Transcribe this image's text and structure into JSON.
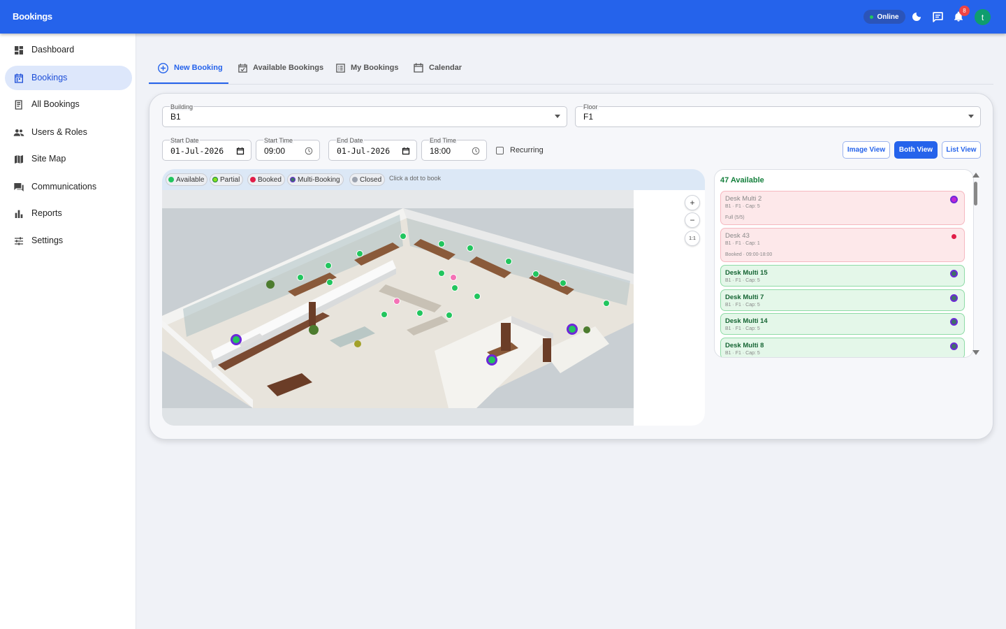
{
  "app": {
    "title": "Bookings"
  },
  "topbar": {
    "status": "Online",
    "notifications_count": "8",
    "avatar_initial": "t"
  },
  "sidebar": {
    "items": [
      {
        "label": "Dashboard",
        "icon": "dashboard-icon"
      },
      {
        "label": "Bookings",
        "icon": "calendar-icon",
        "active": true
      },
      {
        "label": "All Bookings",
        "icon": "book-icon"
      },
      {
        "label": "Users & Roles",
        "icon": "people-icon"
      },
      {
        "label": "Site Map",
        "icon": "map-icon"
      },
      {
        "label": "Communications",
        "icon": "chat-icon"
      },
      {
        "label": "Reports",
        "icon": "bar-chart-icon"
      },
      {
        "label": "Settings",
        "icon": "sliders-icon"
      }
    ]
  },
  "tabs": [
    {
      "label": "New Booking",
      "active": true
    },
    {
      "label": "Available Bookings"
    },
    {
      "label": "My Bookings"
    },
    {
      "label": "Calendar"
    }
  ],
  "form": {
    "building": {
      "label": "Building",
      "value": "B1"
    },
    "floor": {
      "label": "Floor",
      "value": "F1"
    },
    "start_date": {
      "label": "Start Date",
      "value": "01-Jul-2026"
    },
    "start_time": {
      "label": "Start Time",
      "value": "09:00"
    },
    "end_date": {
      "label": "End Date",
      "value": "01-Jul-2026"
    },
    "end_time": {
      "label": "End Time",
      "value": "18:00"
    },
    "recurring": {
      "label": "Recurring",
      "checked": false
    }
  },
  "views": {
    "image": "Image View",
    "both": "Both View",
    "list": "List View",
    "active": "both"
  },
  "legend": {
    "items": [
      {
        "label": "Available",
        "color": "#22c55e"
      },
      {
        "label": "Partial",
        "color": "#84e01f"
      },
      {
        "label": "Booked",
        "color": "#e11d48"
      },
      {
        "label": "Multi-Booking",
        "color": "#6d28d9"
      },
      {
        "label": "Closed",
        "color": "#9ca3af"
      }
    ],
    "hint": "Click a dot to book"
  },
  "zoom": {
    "in": "+",
    "out": "−",
    "reset": "1:1"
  },
  "list": {
    "available_count": "47 Available",
    "items": [
      {
        "title": "Desk Multi 2",
        "sub": "B1 · F1 · Cap: 5",
        "status": "Full (5/5)",
        "state": "booked",
        "dot": "#c026d3"
      },
      {
        "title": "Desk 43",
        "sub": "B1 · F1 · Cap: 1",
        "status": "Booked · 09:00-18:00",
        "state": "booked",
        "dot": "#e11d48"
      },
      {
        "title": "Desk Multi 15",
        "sub": "B1 · F1 · Cap: 5",
        "state": "free",
        "dot": "#3f6f6a"
      },
      {
        "title": "Desk Multi 7",
        "sub": "B1 · F1 · Cap: 5",
        "state": "free",
        "dot": "#3f6f6a"
      },
      {
        "title": "Desk Multi 14",
        "sub": "B1 · F1 · Cap: 5",
        "state": "free",
        "dot": "#3f6f6a"
      },
      {
        "title": "Desk Multi 8",
        "sub": "B1 · F1 · Cap: 5",
        "state": "free",
        "dot": "#3f6f6a"
      }
    ]
  },
  "colors": {
    "primary": "#2563eb",
    "available": "#22c55e",
    "booked": "#e11d48",
    "multi": "#6d28d9"
  }
}
